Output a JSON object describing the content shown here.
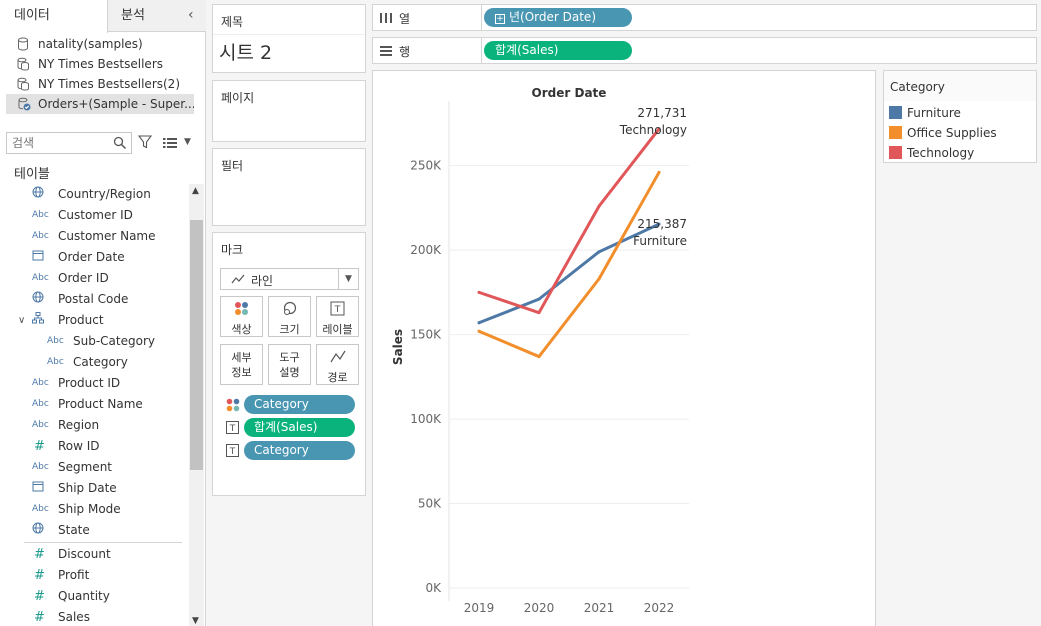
{
  "tabs": {
    "data": "데이터",
    "analytics": "분석"
  },
  "datasources": [
    {
      "label": "natality(samples)"
    },
    {
      "label": "NY Times Bestsellers"
    },
    {
      "label": "NY Times Bestsellers(2)"
    },
    {
      "label": "Orders+(Sample - Super..."
    }
  ],
  "search": {
    "placeholder": "검색"
  },
  "tables_title": "테이블",
  "fields": [
    {
      "type": "globe",
      "label": "Country/Region"
    },
    {
      "type": "Abc",
      "label": "Customer ID"
    },
    {
      "type": "Abc",
      "label": "Customer Name"
    },
    {
      "type": "date",
      "label": "Order Date"
    },
    {
      "type": "Abc",
      "label": "Order ID"
    },
    {
      "type": "globe",
      "label": "Postal Code"
    },
    {
      "type": "hier",
      "label": "Product"
    },
    {
      "type": "Abc",
      "label": "Sub-Category",
      "sub": true
    },
    {
      "type": "Abc",
      "label": "Category",
      "sub": true
    },
    {
      "type": "Abc",
      "label": "Product ID"
    },
    {
      "type": "Abc",
      "label": "Product Name"
    },
    {
      "type": "Abc",
      "label": "Region"
    },
    {
      "type": "hash",
      "label": "Row ID"
    },
    {
      "type": "Abc",
      "label": "Segment"
    },
    {
      "type": "date",
      "label": "Ship Date"
    },
    {
      "type": "Abc",
      "label": "Ship Mode"
    },
    {
      "type": "globe",
      "label": "State"
    }
  ],
  "measures": [
    {
      "type": "hash",
      "label": "Discount"
    },
    {
      "type": "hash",
      "label": "Profit"
    },
    {
      "type": "hash",
      "label": "Quantity"
    },
    {
      "type": "hash",
      "label": "Sales"
    }
  ],
  "title_card": {
    "label": "제목",
    "sheet_name": "시트 2"
  },
  "pages_card": {
    "label": "페이지"
  },
  "filters_card": {
    "label": "필터"
  },
  "marks_card": {
    "label": "마크",
    "mark_type": "라인",
    "buttons": {
      "color": "색상",
      "size": "크기",
      "label": "레이블",
      "detail_l1": "세부",
      "detail_l2": "정보",
      "tooltip_l1": "도구",
      "tooltip_l2": "설명",
      "path": "경로"
    },
    "pills": [
      {
        "label": "Category",
        "kind": "color"
      },
      {
        "label": "합계(Sales)",
        "kind": "label"
      },
      {
        "label": "Category",
        "kind": "label"
      }
    ]
  },
  "columns_shelf": {
    "label": "열",
    "pill": "년(Order Date)"
  },
  "rows_shelf": {
    "label": "행",
    "pill": "합계(Sales)"
  },
  "legend": {
    "title": "Category",
    "items": [
      {
        "label": "Furniture",
        "color": "#4e79a7"
      },
      {
        "label": "Office Supplies",
        "color": "#f28e2b"
      },
      {
        "label": "Technology",
        "color": "#e15759"
      }
    ]
  },
  "colors": {
    "blue_pill": "#4996b2",
    "green_pill": "#0bb37c"
  },
  "chart_data": {
    "type": "line",
    "title": "Order Date",
    "xlabel": "",
    "ylabel": "Sales",
    "categories": [
      "2019",
      "2020",
      "2021",
      "2022"
    ],
    "y_ticks": [
      "0K",
      "50K",
      "100K",
      "150K",
      "200K",
      "250K"
    ],
    "ylim": [
      0,
      280000
    ],
    "grid": true,
    "series": [
      {
        "name": "Furniture",
        "color": "#4e79a7",
        "values": [
          157000,
          171000,
          199000,
          215387
        ]
      },
      {
        "name": "Office Supplies",
        "color": "#f28e2b",
        "values": [
          152000,
          137000,
          183000,
          246000
        ]
      },
      {
        "name": "Technology",
        "color": "#e15759",
        "values": [
          175000,
          163000,
          226000,
          271731
        ]
      }
    ],
    "annotations": [
      {
        "value": "271,731",
        "series": "Technology"
      },
      {
        "value": "215,387",
        "series": "Furniture"
      }
    ]
  }
}
